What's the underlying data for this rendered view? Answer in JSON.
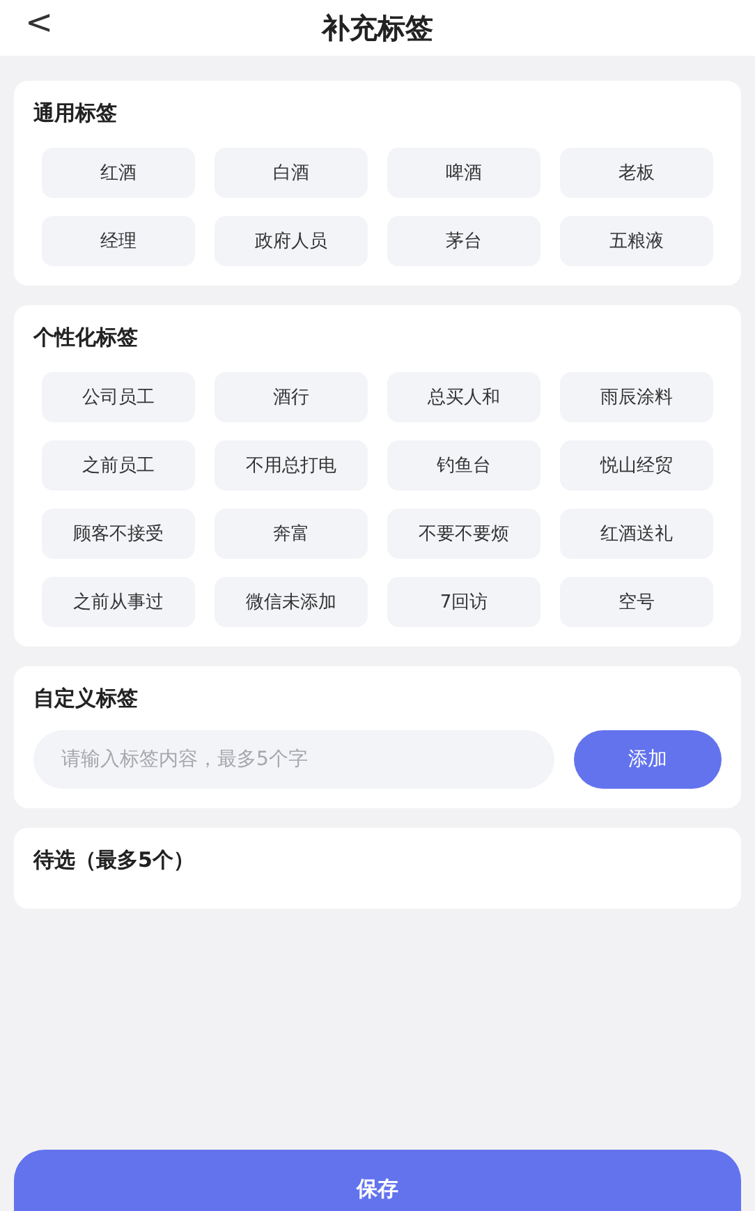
{
  "header": {
    "back": "<",
    "title": "补充标签"
  },
  "sections": [
    {
      "title": "通用标签",
      "tags": [
        "红酒",
        "白酒",
        "啤酒",
        "老板",
        "经理",
        "政府人员",
        "茅台",
        "五粮液"
      ]
    },
    {
      "title": "个性化标签",
      "tags": [
        "公司员工",
        "酒行",
        "总买人和",
        "雨辰涂料",
        "之前员工",
        "不用总打电",
        "钓鱼台",
        "悦山经贸",
        "顾客不接受",
        "奔富",
        "不要不要烦",
        "红酒送礼",
        "之前从事过",
        "微信未添加",
        "7回访",
        "空号"
      ]
    }
  ],
  "custom": {
    "title": "自定义标签",
    "placeholder": "请输入标签内容，最多5个字",
    "button": "添加"
  },
  "pending": {
    "title": "待选（最多5个）"
  },
  "save_button": "保存"
}
